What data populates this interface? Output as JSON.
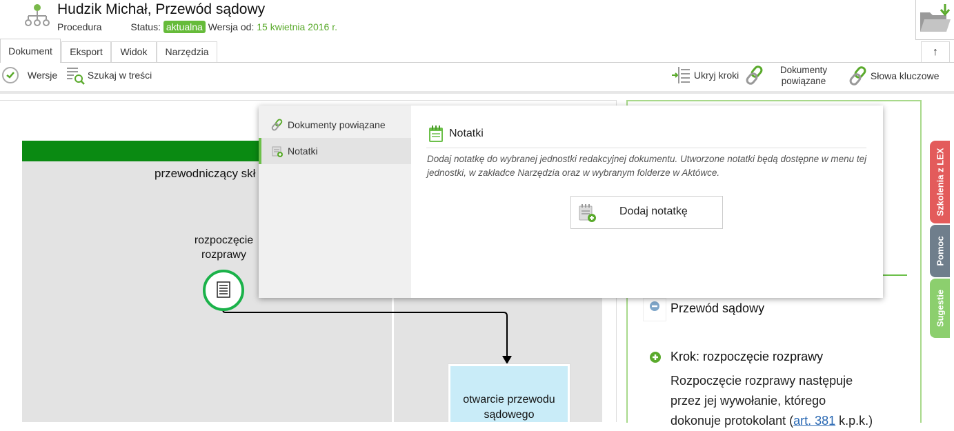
{
  "header": {
    "title": "Hudzik Michał, Przewód sądowy",
    "type": "Procedura",
    "status_label": "Status:",
    "status_badge": "aktualna",
    "version_label": "Wersja od:",
    "version_date": "15 kwietnia 2016 r."
  },
  "tabs": [
    {
      "label": "Dokument",
      "active": true
    },
    {
      "label": "Eksport"
    },
    {
      "label": "Widok"
    },
    {
      "label": "Narzędzia"
    }
  ],
  "toolbar": {
    "versions": "Wersje",
    "search_content": "Szukaj w treści",
    "hide_steps": "Ukryj kroki",
    "related_docs_line1": "Dokumenty",
    "related_docs_line2": "powiązane",
    "keywords": "Słowa kluczowe"
  },
  "diagram": {
    "lane_label": "przewodniczący skł",
    "start_label_line1": "rozpoczęcie",
    "start_label_line2": "rozprawy",
    "task_label_line1": "otwarcie przewodu",
    "task_label_line2": "sądowego"
  },
  "right_panel": {
    "section_title": "Przewód sądowy",
    "step_title": "Krok: rozpoczęcie rozprawy",
    "body_1": "Rozpoczęcie rozprawy następuje przez jej wywołanie, którego dokonuje protokolant (",
    "body_link": "art. 381",
    "body_2": " k.p.k.)"
  },
  "side_tabs": {
    "training": "Szkolenia z LEX",
    "help": "Pomoc",
    "suggestions": "Sugestie"
  },
  "popup": {
    "menu": [
      {
        "label": "Dokumenty powiązane",
        "active": false
      },
      {
        "label": "Notatki",
        "active": true
      }
    ],
    "title": "Notatki",
    "description": "Dodaj notatkę do wybranej jednostki redakcyjnej dokumentu. Utworzone notatki będą dostępne w menu tej jednostki, w zakładce Narzędzia oraz w wybranym folderze w Aktówce.",
    "add_button": "Dodaj notatkę"
  },
  "colors": {
    "accent_green": "#66bb3a",
    "lane_green": "#0a8a12",
    "start_node": "#1bb24a",
    "task_fill": "#c9ecf8",
    "training_tab": "#e35b5b",
    "help_tab": "#6f7e8c",
    "suggestions_tab": "#8ccf6e"
  }
}
